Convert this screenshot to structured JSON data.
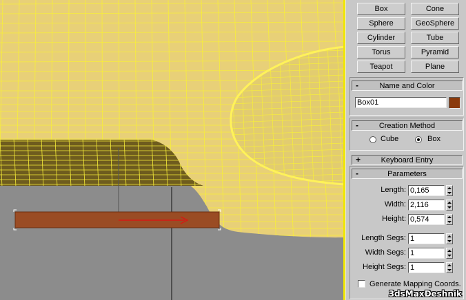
{
  "viewport": {
    "colors": {
      "background": "#8c8c8c",
      "mesh_fill": "#e8d078",
      "wire": "#f7ee3a",
      "box_fill": "#9a4c24",
      "active_border": "#f0e600"
    }
  },
  "object_type": {
    "buttons": [
      "Box",
      "Cone",
      "Sphere",
      "GeoSphere",
      "Cylinder",
      "Tube",
      "Torus",
      "Pyramid",
      "Teapot",
      "Plane"
    ]
  },
  "name_and_color": {
    "title": "Name and Color",
    "sign": "-",
    "name_value": "Box01",
    "color": "#8b3a0c"
  },
  "creation_method": {
    "title": "Creation Method",
    "sign": "-",
    "option_cube": "Cube",
    "option_box": "Box",
    "selected": "Box"
  },
  "keyboard_entry": {
    "title": "Keyboard Entry",
    "sign": "+"
  },
  "parameters": {
    "title": "Parameters",
    "sign": "-",
    "length_label": "Length:",
    "length_value": "0,165",
    "width_label": "Width:",
    "width_value": "2,116",
    "height_label": "Height:",
    "height_value": "0,574",
    "length_segs_label": "Length Segs:",
    "length_segs_value": "1",
    "width_segs_label": "Width Segs:",
    "width_segs_value": "1",
    "height_segs_label": "Height Segs:",
    "height_segs_value": "1",
    "gen_mapping_label": "Generate Mapping Coords.",
    "gen_mapping_checked": false
  },
  "watermark": "3dsMaxDeshnik"
}
